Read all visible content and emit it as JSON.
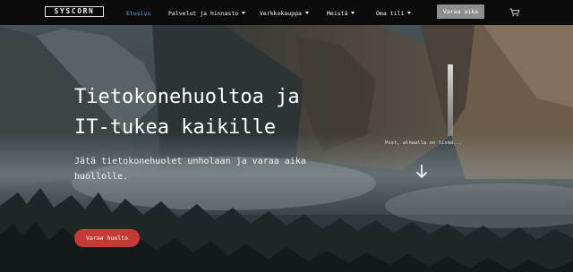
{
  "brand": {
    "logo_text": "SYSCORN"
  },
  "nav": {
    "items": [
      {
        "label": "Etusivu",
        "active": true,
        "dropdown": false
      },
      {
        "label": "Palvelut ja hinnasto",
        "active": false,
        "dropdown": true
      },
      {
        "label": "Verkkokauppa",
        "active": false,
        "dropdown": true
      },
      {
        "label": "Meistä",
        "active": false,
        "dropdown": true
      },
      {
        "label": "Oma tili",
        "active": false,
        "dropdown": true
      }
    ],
    "book_button": "Varaa aika",
    "cart_icon": "cart-icon"
  },
  "hero": {
    "headline_line1": "Tietokonehuoltoa ja",
    "headline_line2": "IT-tukea kaikille",
    "subtext_line1": "Jätä tietokonehuolet unholaan ja varaa aika",
    "subtext_line2": "huollolle.",
    "hint": "Psst, alhaalla on lisää...",
    "scroll_icon": "arrow-down-icon",
    "cta_label": "Varaa huolto"
  },
  "colors": {
    "nav_bg": "#0b0b0c",
    "active_link": "#5fa8e0",
    "book_button": "#8e8e8e",
    "cta": "#c53a35"
  }
}
